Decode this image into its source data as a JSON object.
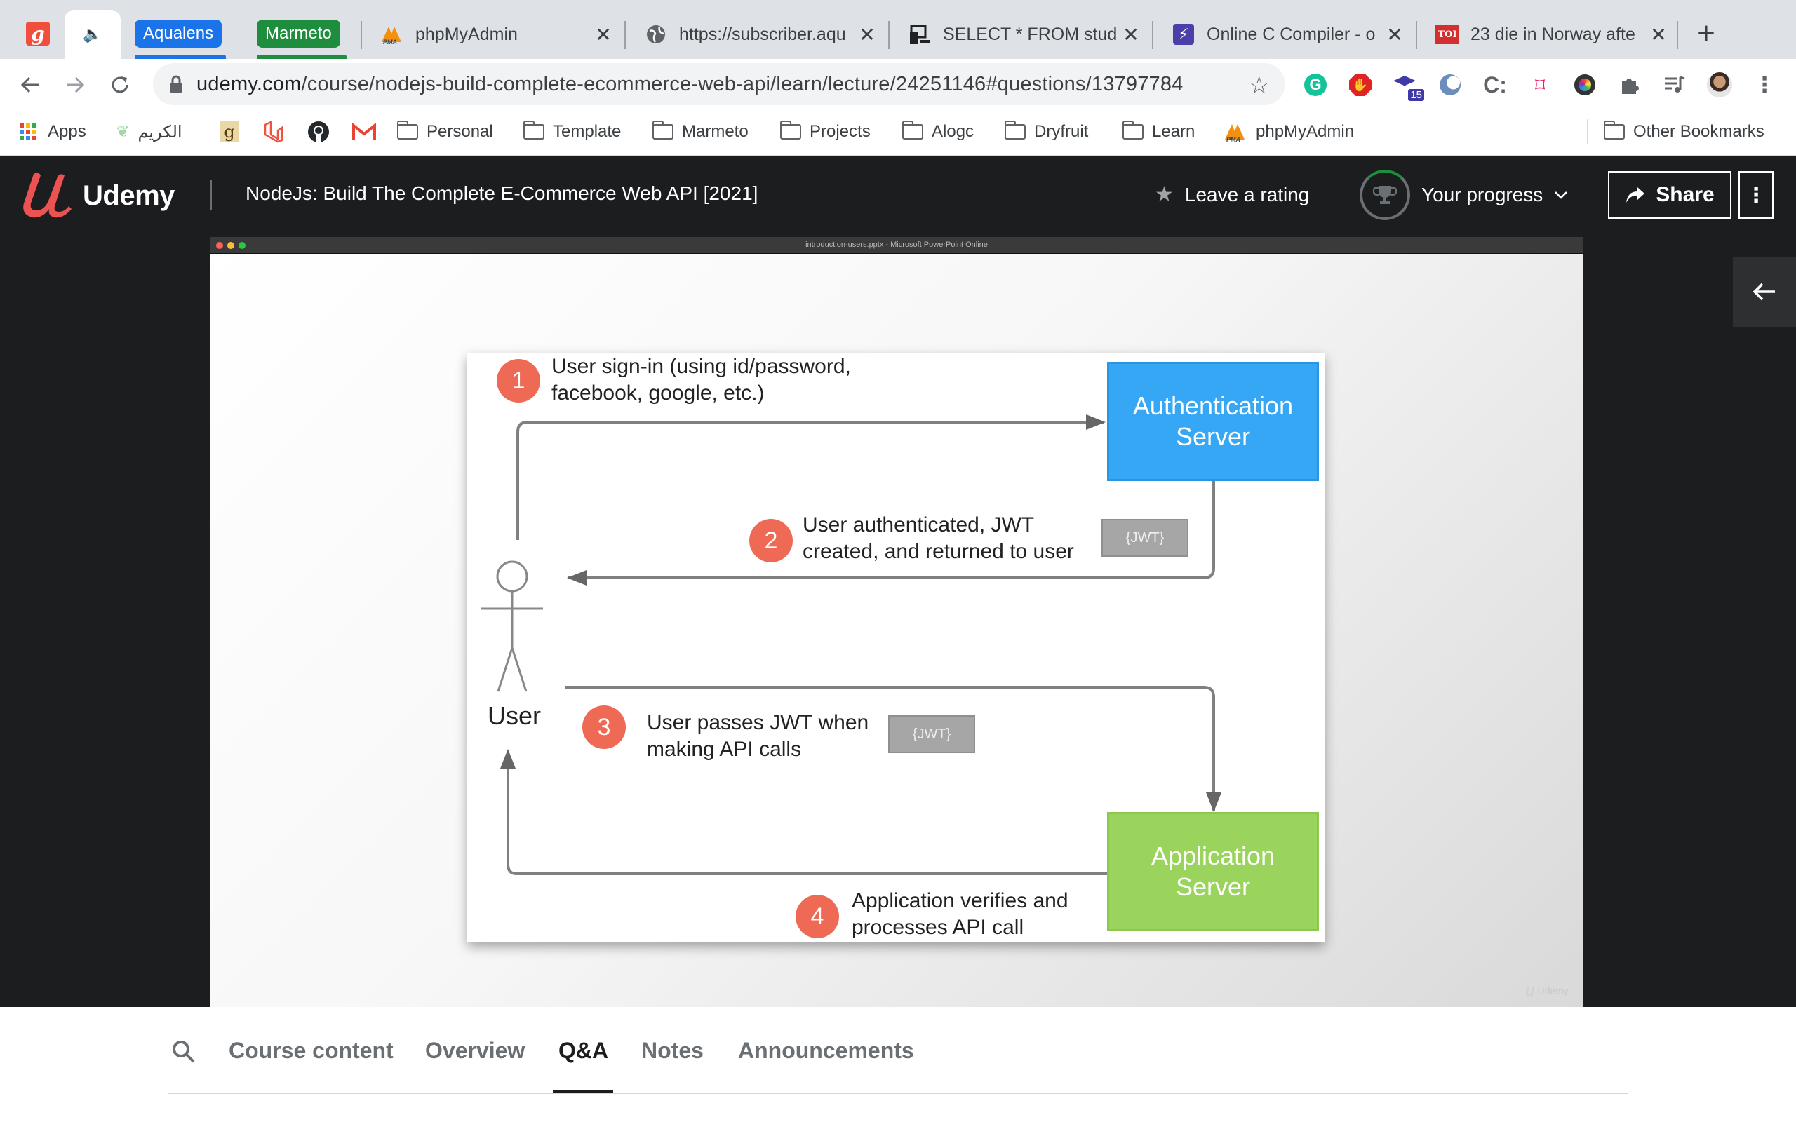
{
  "browser": {
    "tabs": [
      {
        "title": "",
        "icon": "g-app-icon"
      },
      {
        "title": "",
        "icon": "speaker-icon"
      },
      {
        "title": "phpMyAdmin",
        "icon": "phpmyadmin-icon"
      },
      {
        "title": "https://subscriber.aqu",
        "icon": "globe-icon"
      },
      {
        "title": "SELECT * FROM stude",
        "icon": "db-icon"
      },
      {
        "title": "Online C Compiler - o",
        "icon": "bolt-icon"
      },
      {
        "title": "23 die in Norway afte",
        "icon": "toi-icon"
      }
    ],
    "tab_groups": [
      {
        "label": "Aqualens",
        "color": "#1a73e8"
      },
      {
        "label": "Marmeto",
        "color": "#1e8e3e"
      }
    ],
    "new_tab": "+",
    "address": {
      "domain": "udemy.com",
      "path": "/course/nodejs-build-complete-ecommerce-web-api/learn/lecture/24251146#questions/13797784"
    },
    "extension_badge": "15",
    "bookmarks": [
      {
        "label": "Apps",
        "type": "apps"
      },
      {
        "label": "الكريم",
        "type": "site"
      },
      {
        "label": "",
        "type": "g"
      },
      {
        "label": "",
        "type": "laravel"
      },
      {
        "label": "",
        "type": "github"
      },
      {
        "label": "",
        "type": "gmail"
      },
      {
        "label": "Personal",
        "type": "folder"
      },
      {
        "label": "Template",
        "type": "folder"
      },
      {
        "label": "Marmeto",
        "type": "folder"
      },
      {
        "label": "Projects",
        "type": "folder"
      },
      {
        "label": "Alogc",
        "type": "folder"
      },
      {
        "label": "Dryfruit",
        "type": "folder"
      },
      {
        "label": "Learn",
        "type": "folder"
      },
      {
        "label": "phpMyAdmin",
        "type": "pma"
      }
    ],
    "other_bookmarks": "Other Bookmarks"
  },
  "udemy": {
    "logo": "Udemy",
    "course_title": "NodeJs: Build The Complete E-Commerce Web API [2021]",
    "rating_label": "Leave a rating",
    "progress_label": "Your progress",
    "share_label": "Share",
    "colors": {
      "header_bg": "#1c1d1f",
      "brand": "#a435f0",
      "logo_red": "#ec5252"
    }
  },
  "video": {
    "window_title": "introduction-users.pptx - Microsoft PowerPoint Online",
    "watermark": "Udemy",
    "diagram": {
      "auth_server": "Authentication Server",
      "app_server": "Application Server",
      "user": "User",
      "steps": [
        {
          "num": "1",
          "line1": "User sign-in (using id/password,",
          "line2": "facebook, google, etc.)"
        },
        {
          "num": "2",
          "line1": "User authenticated, JWT",
          "line2": "created, and returned to user"
        },
        {
          "num": "3",
          "line1": "User passes JWT when",
          "line2": "making API calls"
        },
        {
          "num": "4",
          "line1": "Application verifies and",
          "line2": "processes API call"
        }
      ],
      "jwt_token": "{JWT}",
      "colors": {
        "auth": "#35a7f5",
        "app": "#9ad45c",
        "step": "#ef6a55",
        "token": "#a6a6a6"
      }
    }
  },
  "bottom_tabs": {
    "items": [
      "Course content",
      "Overview",
      "Q&A",
      "Notes",
      "Announcements"
    ],
    "active": "Q&A"
  }
}
